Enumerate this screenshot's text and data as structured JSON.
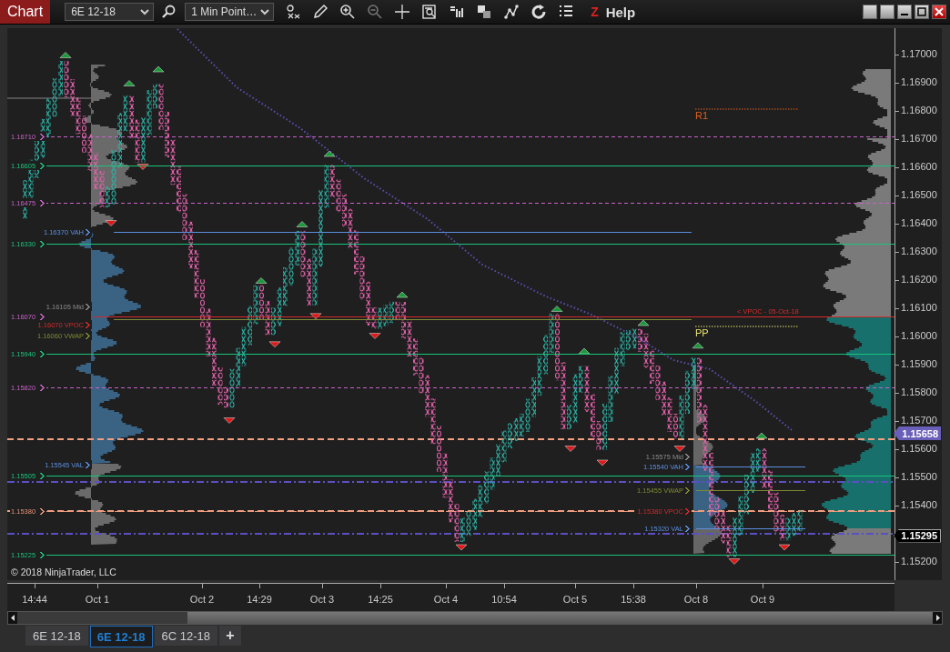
{
  "toolbar": {
    "title": "Chart",
    "instrument": "6E 12-18",
    "interval": "1 Min Point…",
    "help_key": "Z",
    "help": "Help"
  },
  "chart": {
    "levels": [
      {
        "label": "1.16710",
        "kind": "left",
        "color": "#c862c8",
        "line": true,
        "dashed": true
      },
      {
        "label": "1.16605",
        "kind": "left",
        "color": "#18c47c",
        "line": true,
        "dashed": false
      },
      {
        "label": "1.16475",
        "kind": "left",
        "color": "#c862c8",
        "line": true,
        "dashed": true
      },
      {
        "label": "1.16370 VAH",
        "kind": "session",
        "color": "#5b8ee0",
        "line": true,
        "dashed": false
      },
      {
        "label": "1.16330",
        "kind": "left",
        "color": "#18c47c",
        "line": true,
        "dashed": false
      },
      {
        "label": "1.16105 Mid",
        "kind": "session",
        "color": "#8a8a8a",
        "line": false
      },
      {
        "label": "1.16070",
        "kind": "left",
        "color": "#c862c8",
        "line": false
      },
      {
        "label": "1.16070 VPOC",
        "kind": "session",
        "color": "#d42a2a",
        "line": true,
        "dashed": false,
        "extended": true,
        "note": "< VPOC - 05-Oct-18"
      },
      {
        "label": "1.16060 VWAP",
        "kind": "session",
        "color": "#7f8a34",
        "line": true,
        "dashed": false
      },
      {
        "label": "1.15940",
        "kind": "left",
        "color": "#18c47c",
        "line": true,
        "dashed": false
      },
      {
        "label": "1.15820",
        "kind": "left",
        "color": "#c862c8",
        "line": true,
        "dashed": true
      },
      {
        "label": "1.15545 VAL",
        "kind": "session",
        "color": "#5b8ee0",
        "line": false
      },
      {
        "label": "1.15505",
        "kind": "left",
        "color": "#18c47c",
        "line": true,
        "dashed": false
      },
      {
        "label": "1.15380",
        "kind": "left",
        "color": "#e8957a",
        "line": true,
        "dashed": true
      },
      {
        "label": "1.15225",
        "kind": "left",
        "color": "#18c47c",
        "line": true,
        "dashed": false
      },
      {
        "label": "1.15575 Mid",
        "kind": "recent",
        "color": "#8a8a8a",
        "line": false
      },
      {
        "label": "1.15540 VAH",
        "kind": "recent",
        "color": "#5b8ee0",
        "line": true,
        "dashed": false
      },
      {
        "label": "1.15455 VWAP",
        "kind": "recent",
        "color": "#7f8a34",
        "line": true,
        "dashed": false
      },
      {
        "label": "1.15380 VPOC",
        "kind": "recent",
        "color": "#d42a2a",
        "line": false
      },
      {
        "label": "1.15320 VAL",
        "kind": "recent",
        "color": "#5b8ee0",
        "line": true,
        "dashed": false
      }
    ],
    "pivots": [
      {
        "label": "R1",
        "color": "#e0601e"
      },
      {
        "label": "PP",
        "color": "#e8e070"
      }
    ],
    "copyright": "© 2018 NinjaTrader, LLC",
    "price_axis": {
      "ticks": [
        "1.17000",
        "1.16900",
        "1.16800",
        "1.16700",
        "1.16600",
        "1.16500",
        "1.16400",
        "1.16300",
        "1.16200",
        "1.16100",
        "1.16000",
        "1.15900",
        "1.15800",
        "1.15700",
        "1.15600",
        "1.15500",
        "1.15400",
        "1.15200"
      ],
      "last_price": "1.15658",
      "marker_price": "1.15295"
    },
    "time_axis": [
      "14:44",
      "Oct 1",
      "Oct 2",
      "14:29",
      "Oct 3",
      "14:25",
      "Oct 4",
      "10:54",
      "Oct 5",
      "15:38",
      "Oct 8",
      "Oct 9"
    ]
  },
  "tabs": [
    {
      "label": "6E 12-18",
      "selected": false
    },
    {
      "label": "6E 12-18",
      "selected": true
    },
    {
      "label": "6C 12-18",
      "selected": false
    }
  ],
  "add_tab": "+"
}
